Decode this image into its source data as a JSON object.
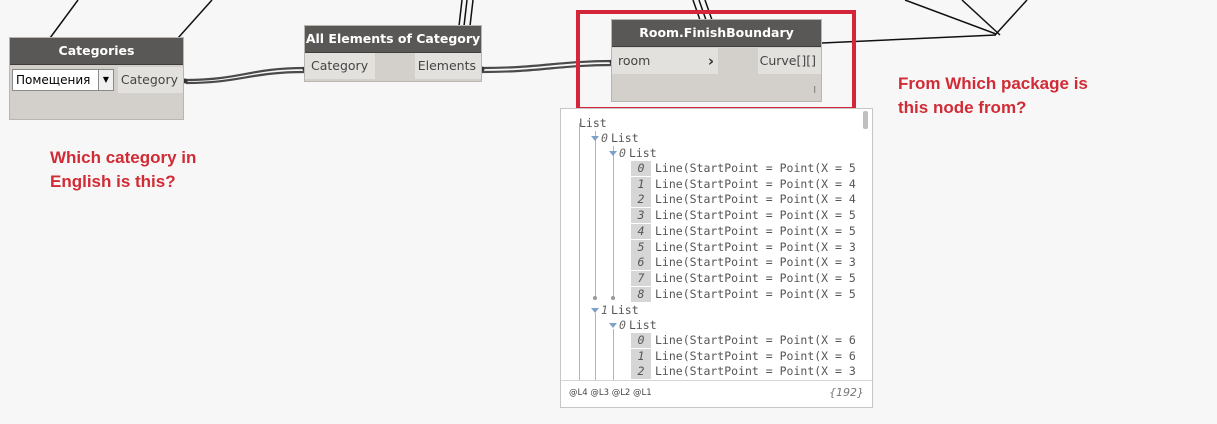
{
  "nodes": {
    "categories": {
      "title": "Categories",
      "dropdown_value": "Помещения",
      "output": "Category"
    },
    "all_elements": {
      "title": "All Elements of Category",
      "input": "Category",
      "output": "Elements"
    },
    "finish_boundary": {
      "title": "Room.FinishBoundary",
      "input": "room",
      "output": "Curve[][]",
      "lacing": "l",
      "arrow": "›"
    }
  },
  "preview": {
    "root": "List",
    "groups": [
      {
        "index": "0",
        "label": "List",
        "sub_index": "0",
        "sub_label": "List",
        "items": [
          {
            "i": "0",
            "text": "Line(StartPoint = Point(X = 5"
          },
          {
            "i": "1",
            "text": "Line(StartPoint = Point(X = 4"
          },
          {
            "i": "2",
            "text": "Line(StartPoint = Point(X = 4"
          },
          {
            "i": "3",
            "text": "Line(StartPoint = Point(X = 5"
          },
          {
            "i": "4",
            "text": "Line(StartPoint = Point(X = 5"
          },
          {
            "i": "5",
            "text": "Line(StartPoint = Point(X = 3"
          },
          {
            "i": "6",
            "text": "Line(StartPoint = Point(X = 3"
          },
          {
            "i": "7",
            "text": "Line(StartPoint = Point(X = 5"
          },
          {
            "i": "8",
            "text": "Line(StartPoint = Point(X = 5"
          }
        ]
      },
      {
        "index": "1",
        "label": "List",
        "sub_index": "0",
        "sub_label": "List",
        "items": [
          {
            "i": "0",
            "text": "Line(StartPoint = Point(X = 6"
          },
          {
            "i": "1",
            "text": "Line(StartPoint = Point(X = 6"
          },
          {
            "i": "2",
            "text": "Line(StartPoint = Point(X = 3"
          }
        ]
      }
    ],
    "levels": "@L4 @L3 @L2 @L1",
    "count": "{192}"
  },
  "annotations": {
    "category_question": "Which category in English is this?",
    "package_question": "From Which package is this node from?"
  },
  "colors": {
    "annotation": "#d12b35",
    "highlight_border": "#d4253a",
    "node_header": "#5a5856",
    "node_body": "#d3d0cb",
    "wire": "#555555"
  }
}
